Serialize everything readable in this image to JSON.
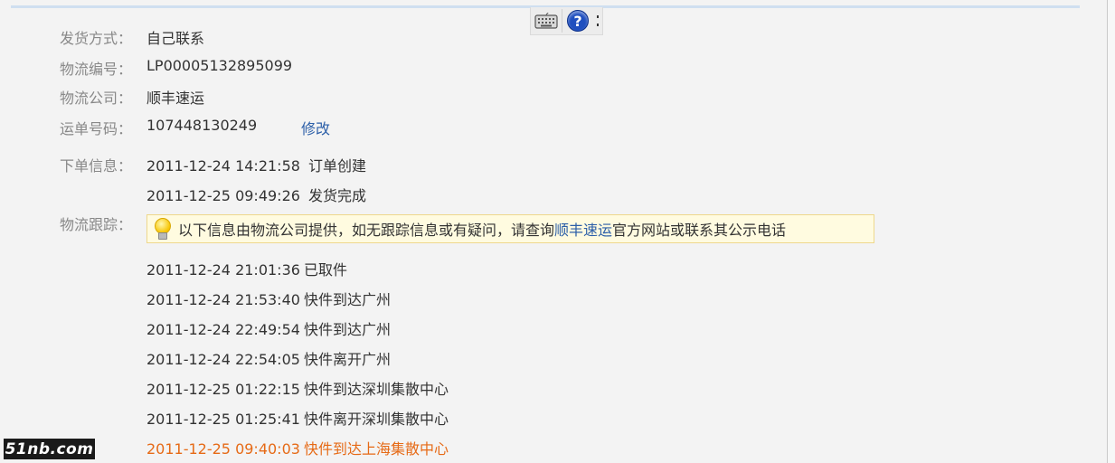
{
  "toolbar": {
    "icons": [
      "keyboard-icon",
      "help-icon"
    ],
    "help_glyph": "?"
  },
  "shipping": {
    "method_label": "发货方式：",
    "method_value": "自己联系",
    "tracking_no_label": "物流编号：",
    "tracking_no_value": "LP00005132895099",
    "company_label": "物流公司：",
    "company_value": "顺丰速运",
    "waybill_label": "运单号码：",
    "waybill_value": "107448130249",
    "waybill_edit": "修改"
  },
  "order_info": {
    "label": "下单信息：",
    "events": [
      {
        "time": "2011-12-24 14:21:58",
        "text": "订单创建"
      },
      {
        "time": "2011-12-25 09:49:26",
        "text": "发货完成"
      }
    ]
  },
  "tracking": {
    "label": "物流跟踪：",
    "tip_prefix": "以下信息由物流公司提供，如无跟踪信息或有疑问，请查询",
    "tip_link": "顺丰速运",
    "tip_suffix": "官方网站或联系其公示电话",
    "events": [
      {
        "time": "2011-12-24 21:01:36",
        "text": "已取件"
      },
      {
        "time": "2011-12-24 21:53:40",
        "text": "快件到达广州"
      },
      {
        "time": "2011-12-24 22:49:54",
        "text": "快件到达广州"
      },
      {
        "time": "2011-12-24 22:54:05",
        "text": "快件离开广州"
      },
      {
        "time": "2011-12-25 01:22:15",
        "text": "快件到达深圳集散中心"
      },
      {
        "time": "2011-12-25 01:25:41",
        "text": "快件离开深圳集散中心"
      },
      {
        "time": "2011-12-25 09:40:03",
        "text": "快件到达上海集散中心"
      }
    ],
    "latest_color": "#e66a16"
  },
  "watermark": {
    "text": "51nb.com"
  },
  "colors": {
    "link": "#2c5fa8",
    "label": "#888888",
    "tip_bg": "#fffbe0",
    "tip_border": "#eed88d"
  }
}
